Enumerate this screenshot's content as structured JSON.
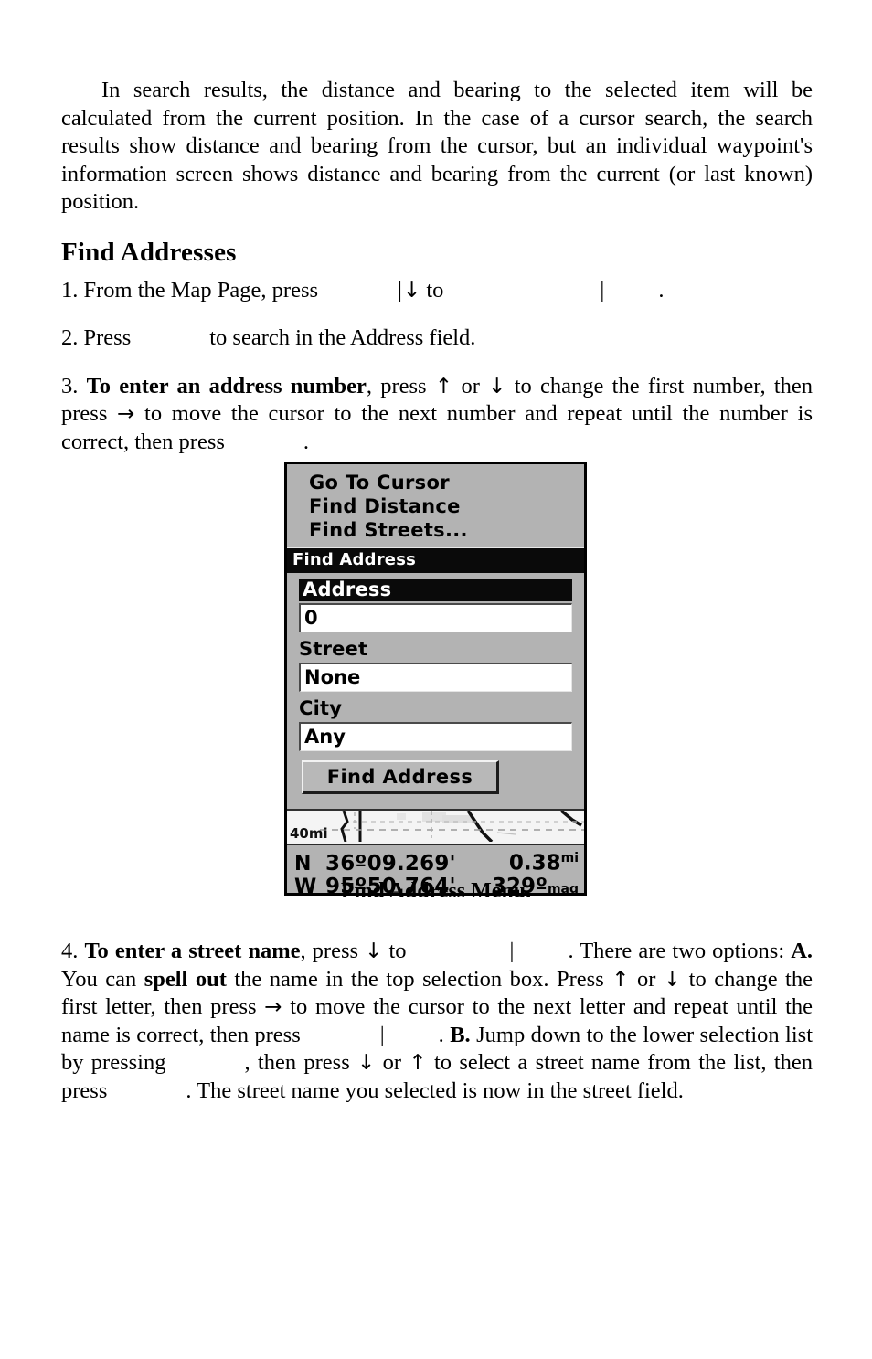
{
  "page": {
    "intro_paragraph": "In search results, the distance and bearing to the selected item will be calculated from the current position. In the case of a cursor search, the search results show distance and bearing from the cursor, but an individual waypoint's information screen shows distance and bearing from the current (or last known) position.",
    "heading": "Find Addresses"
  },
  "steps": {
    "step1": {
      "number": "1.",
      "text_a": "From the Map Page, press",
      "bar1": "|",
      "arrow": "↓",
      "text_b": "to",
      "bar2": "|",
      "text_c": "."
    },
    "step2": {
      "number": "2.",
      "text_a": "Press",
      "text_b": "to search in the Address field."
    },
    "step3": {
      "number": "3.",
      "bold_a": "To enter an address number",
      "text_a": ", press",
      "arrow_up": "↑",
      "text_or": "or",
      "arrow_down": "↓",
      "text_b": "to change the first number, then press",
      "arrow_right": "→",
      "text_c": "to move the cursor to the next number and repeat until the number is correct, then press",
      "text_d": "."
    },
    "step4": {
      "number": "4.",
      "bold_a": "To enter a street name",
      "text_a": ", press",
      "arrow_down": "↓",
      "text_b": "to",
      "bar1": "|",
      "text_c": ". There are two options:",
      "bold_b": "A.",
      "text_d": "You can",
      "bold_c": "spell out",
      "text_e": "the name in the top selection box. Press",
      "arrow_up": "↑",
      "text_f": "or",
      "arrow_down2": "↓",
      "text_g": "to change the first letter, then press",
      "arrow_right": "→",
      "text_h": "to move the cursor to the next letter and repeat until the name is correct, then press",
      "bar2": "|",
      "text_i": ".",
      "bold_d": "B.",
      "text_j": "Jump down to the lower selection list by pressing",
      "text_k": ", then press",
      "arrow_down3": "↓",
      "text_l": "or",
      "arrow_up2": "↑",
      "text_m": "to select a street name from the list, then press",
      "text_n": ". The street name you selected is now in the street field."
    }
  },
  "device_screenshot": {
    "menu_items": [
      "Go To Cursor",
      "Find Distance",
      "Find Streets..."
    ],
    "title_bar": "Find Address",
    "fields": [
      {
        "label": "Address",
        "value": "0",
        "selected": true
      },
      {
        "label": "Street",
        "value": "None",
        "selected": false
      },
      {
        "label": "City",
        "value": "Any",
        "selected": false
      }
    ],
    "button_label": "Find Address",
    "map_scale": "40mi",
    "status": {
      "lat_hemisphere": "N",
      "latitude": "36º09.269'",
      "lon_hemisphere": "W",
      "longitude": "95º50.764'",
      "distance_value": "0.38",
      "distance_unit": "mi",
      "bearing_value": "329º",
      "bearing_unit": "mag"
    },
    "colors": {
      "screen_bg": "#b3b3b3",
      "highlight_bg": "#0a0a0a",
      "highlight_fg": "#ffffff",
      "field_bg": "#ffffff",
      "border": "#000000"
    }
  },
  "caption": "Find Address Menu."
}
